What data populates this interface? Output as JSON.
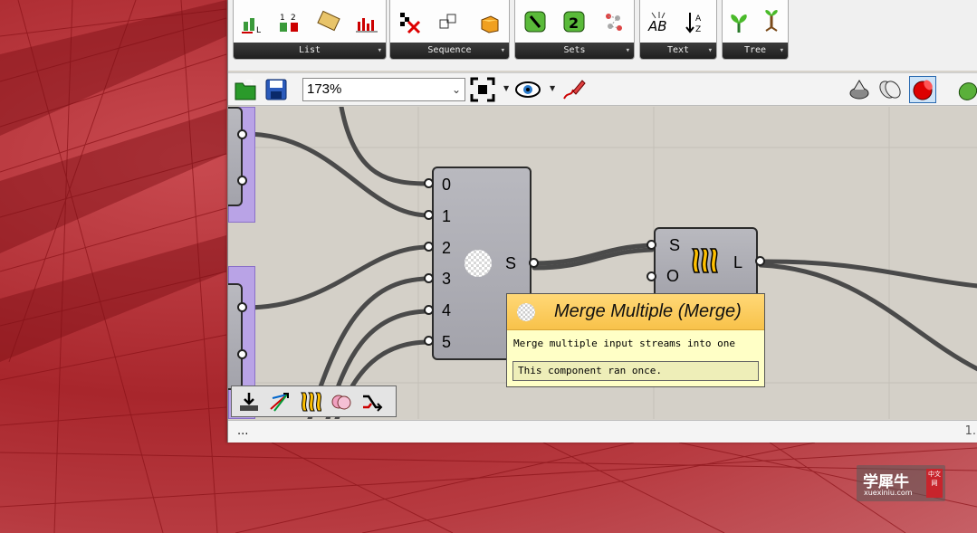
{
  "ribbon": {
    "groups": [
      {
        "label": "List"
      },
      {
        "label": "Sequence"
      },
      {
        "label": "Sets"
      },
      {
        "label": "Text"
      },
      {
        "label": "Tree"
      }
    ],
    "group_arrow": "▾"
  },
  "toolbar": {
    "zoom_value": "173%"
  },
  "canvas": {
    "merge_component": {
      "inputs": [
        "0",
        "1",
        "2",
        "3",
        "4",
        "5"
      ],
      "output": "S"
    },
    "second_component": {
      "inputs": [
        "S",
        "O"
      ],
      "output": "L"
    }
  },
  "tooltip": {
    "title": "Merge Multiple (Merge)",
    "description": "Merge multiple input streams into one",
    "status": "This component ran once."
  },
  "status_bar": {
    "text": "...",
    "right_text": "1."
  },
  "watermark": {
    "main": "学犀牛",
    "sub": "xuexiniu.com",
    "box": "中文网"
  },
  "colors": {
    "viewport_bg": "#b22a30",
    "component_fill": "#a8a8b0",
    "tooltip_header": "#f8c24a",
    "tooltip_body": "#ffffc6",
    "group_fill": "#b9a3e6"
  }
}
